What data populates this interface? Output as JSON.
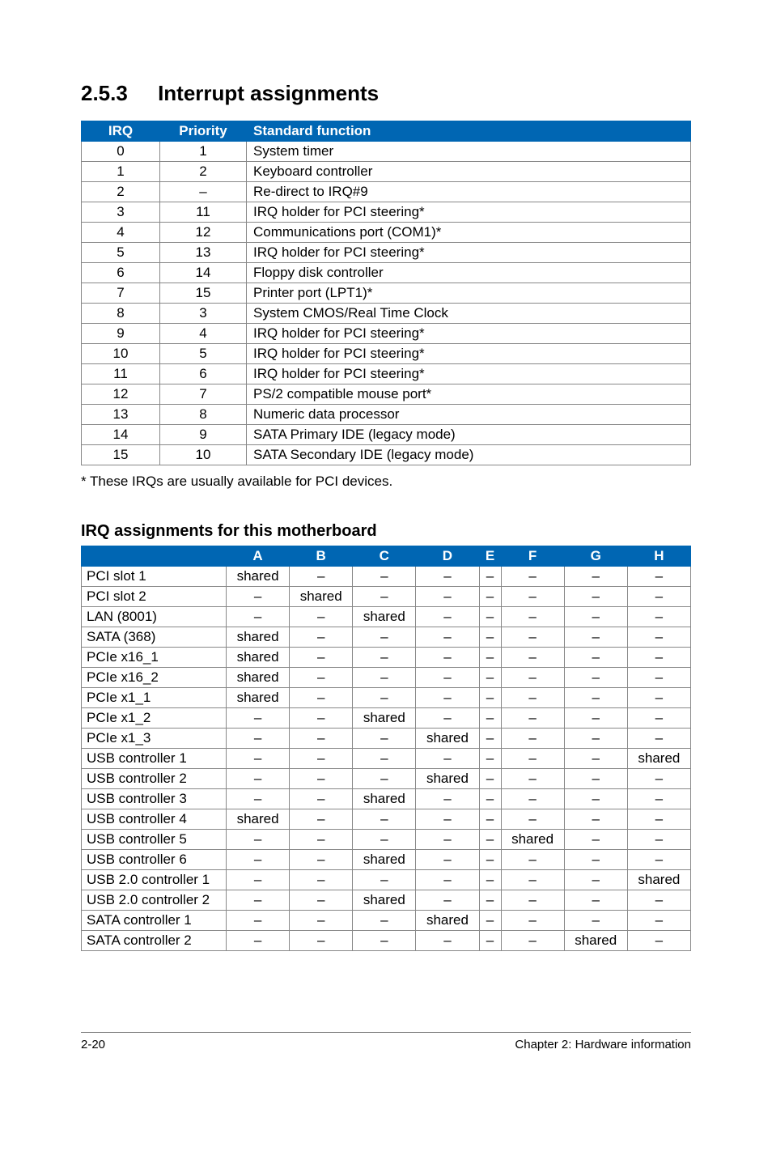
{
  "section": {
    "number": "2.5.3",
    "title": "Interrupt assignments"
  },
  "irq_table": {
    "headers": {
      "irq": "IRQ",
      "priority": "Priority",
      "fn": "Standard function"
    },
    "rows": [
      {
        "irq": "0",
        "priority": "1",
        "fn": "System timer"
      },
      {
        "irq": "1",
        "priority": "2",
        "fn": "Keyboard controller"
      },
      {
        "irq": "2",
        "priority": "–",
        "fn": "Re-direct to IRQ#9"
      },
      {
        "irq": "3",
        "priority": "11",
        "fn": "IRQ holder for PCI steering*"
      },
      {
        "irq": "4",
        "priority": "12",
        "fn": "Communications port (COM1)*"
      },
      {
        "irq": "5",
        "priority": "13",
        "fn": "IRQ holder for PCI steering*"
      },
      {
        "irq": "6",
        "priority": "14",
        "fn": "Floppy disk controller"
      },
      {
        "irq": "7",
        "priority": "15",
        "fn": "Printer port (LPT1)*"
      },
      {
        "irq": "8",
        "priority": "3",
        "fn": "System CMOS/Real Time Clock"
      },
      {
        "irq": "9",
        "priority": "4",
        "fn": "IRQ holder for PCI steering*"
      },
      {
        "irq": "10",
        "priority": "5",
        "fn": "IRQ holder for PCI steering*"
      },
      {
        "irq": "11",
        "priority": "6",
        "fn": "IRQ holder for PCI steering*"
      },
      {
        "irq": "12",
        "priority": "7",
        "fn": "PS/2 compatible mouse port*"
      },
      {
        "irq": "13",
        "priority": "8",
        "fn": "Numeric data processor"
      },
      {
        "irq": "14",
        "priority": "9",
        "fn": "SATA Primary IDE (legacy mode)"
      },
      {
        "irq": "15",
        "priority": "10",
        "fn": "SATA Secondary IDE (legacy mode)"
      }
    ]
  },
  "footnote": "* These IRQs are usually available for PCI devices.",
  "sub_title": "IRQ assignments for this motherboard",
  "assign_table": {
    "cols": [
      "A",
      "B",
      "C",
      "D",
      "E",
      "F",
      "G",
      "H"
    ],
    "rows": [
      {
        "label": "PCI slot 1",
        "cells": [
          "shared",
          "–",
          "–",
          "–",
          "–",
          "–",
          "–",
          "–"
        ]
      },
      {
        "label": "PCI slot 2",
        "cells": [
          "–",
          "shared",
          "–",
          "–",
          "–",
          "–",
          "–",
          "–"
        ]
      },
      {
        "label": "LAN (8001)",
        "cells": [
          "–",
          "–",
          "shared",
          "–",
          "–",
          "–",
          "–",
          "–"
        ]
      },
      {
        "label": "SATA (368)",
        "cells": [
          "shared",
          "–",
          "–",
          "–",
          "–",
          "–",
          "–",
          "–"
        ]
      },
      {
        "label": "PCIe x16_1",
        "cells": [
          "shared",
          "–",
          "–",
          "–",
          "–",
          "–",
          "–",
          "–"
        ]
      },
      {
        "label": "PCIe x16_2",
        "cells": [
          "shared",
          "–",
          "–",
          "–",
          "–",
          "–",
          "–",
          "–"
        ]
      },
      {
        "label": "PCIe x1_1",
        "cells": [
          "shared",
          "–",
          "–",
          "–",
          "–",
          "–",
          "–",
          "–"
        ]
      },
      {
        "label": "PCIe x1_2",
        "cells": [
          "–",
          "–",
          "shared",
          "–",
          "–",
          "–",
          "–",
          "–"
        ]
      },
      {
        "label": "PCIe x1_3",
        "cells": [
          "–",
          "–",
          "–",
          "shared",
          "–",
          "–",
          "–",
          "–"
        ]
      },
      {
        "label": "USB controller 1",
        "cells": [
          "–",
          "–",
          "–",
          "–",
          "–",
          "–",
          "–",
          "shared"
        ]
      },
      {
        "label": "USB controller 2",
        "cells": [
          "–",
          "–",
          "–",
          "shared",
          "–",
          "–",
          "–",
          "–"
        ]
      },
      {
        "label": "USB controller 3",
        "cells": [
          "–",
          "–",
          "shared",
          "–",
          "–",
          "–",
          "–",
          "–"
        ]
      },
      {
        "label": "USB controller 4",
        "cells": [
          "shared",
          "–",
          "–",
          "–",
          "–",
          "–",
          "–",
          "–"
        ]
      },
      {
        "label": "USB controller 5",
        "cells": [
          "–",
          "–",
          "–",
          "–",
          "–",
          "shared",
          "–",
          "–"
        ]
      },
      {
        "label": "USB controller 6",
        "cells": [
          "–",
          "–",
          "shared",
          "–",
          "–",
          "–",
          "–",
          "–"
        ]
      },
      {
        "label": "USB 2.0 controller 1",
        "cells": [
          "–",
          "–",
          "–",
          "–",
          "–",
          "–",
          "–",
          "shared"
        ]
      },
      {
        "label": "USB 2.0 controller 2",
        "cells": [
          "–",
          "–",
          "shared",
          "–",
          "–",
          "–",
          "–",
          "–"
        ]
      },
      {
        "label": "SATA controller 1",
        "cells": [
          "–",
          "–",
          "–",
          "shared",
          "–",
          "–",
          "–",
          "–"
        ]
      },
      {
        "label": "SATA controller 2",
        "cells": [
          "–",
          "–",
          "–",
          "–",
          "–",
          "–",
          "shared",
          "–"
        ]
      }
    ]
  },
  "footer": {
    "left": "2-20",
    "right": "Chapter 2: Hardware information"
  }
}
